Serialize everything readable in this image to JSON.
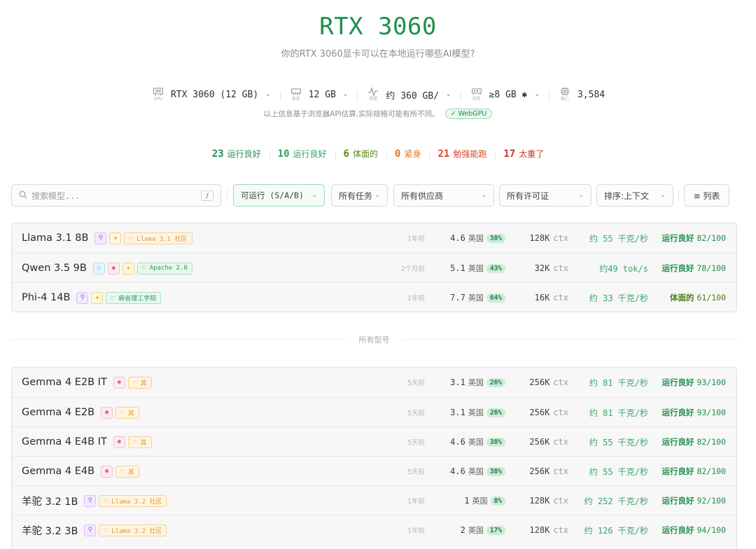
{
  "header": {
    "title": "RTX 3060",
    "subtitle": "你的RTX 3060显卡可以在本地运行哪些AI模型?"
  },
  "specs": [
    {
      "cap": "GPU",
      "value": "RTX 3060 (12 GB)",
      "caret": "⌄",
      "icon": "gpu-icon"
    },
    {
      "cap": "显存",
      "value": "12 GB",
      "caret": "⌄",
      "icon": "vram-icon"
    },
    {
      "cap": "带宽",
      "value": "约 360 GB/",
      "caret": "⌄",
      "icon": "bandwidth-icon"
    },
    {
      "cap": "内存",
      "value": "≥8 GB ✱",
      "caret": "⌄",
      "icon": "memory-icon"
    },
    {
      "cap": "核心",
      "value": "3,584",
      "caret": "",
      "icon": "cpu-icon"
    }
  ],
  "note": {
    "text": "以上信息基于浏览器API估算,实际规格可能有所不同。",
    "badge": "✓ WebGPU"
  },
  "summary": [
    {
      "count": "23",
      "label": "运行良好",
      "color": "#1f8f4e"
    },
    {
      "count": "10",
      "label": "运行良好",
      "color": "#2ea35f"
    },
    {
      "count": "6",
      "label": "体面的",
      "color": "#5c8a1c"
    },
    {
      "count": "0",
      "label": "紧身",
      "color": "#e07a1f"
    },
    {
      "count": "21",
      "label": "勉强能跑",
      "color": "#d9452b"
    },
    {
      "count": "17",
      "label": "太重了",
      "color": "#c8362a"
    }
  ],
  "filters": {
    "search_placeholder": "搜索模型...",
    "search_shortcut": "/",
    "runnable": "可运行 (S/A/B)",
    "tasks": "所有任务",
    "vendors": "所有供应商",
    "licenses": "所有许可证",
    "sort": "排序:上下文",
    "view": "≡ 列表"
  },
  "featured": [
    {
      "name": "Llama 3.1 8B",
      "tags": [
        {
          "t": "purple",
          "g": "⚲",
          "k": "tool-icon"
        },
        {
          "t": "star",
          "g": "★",
          "k": "star-icon"
        }
      ],
      "license": {
        "style": "lic-o",
        "text": "♡ Llama 3.1 社区"
      },
      "age": "1年前",
      "size": "4.6",
      "unit": "英国",
      "pct": "38%",
      "ctx": "128K",
      "ctx_unit": "ctx",
      "speed": "约 55 千克/秒",
      "grade": "运行良好",
      "score": "82/100",
      "gcolor": "#1f8f4e"
    },
    {
      "name": "Qwen 3.5 9B",
      "tags": [
        {
          "t": "blue",
          "g": "◌",
          "k": "lightbulb-icon"
        },
        {
          "t": "pink",
          "g": "◉",
          "k": "eye-icon"
        },
        {
          "t": "star",
          "g": "★",
          "k": "star-icon"
        }
      ],
      "license": {
        "style": "lic-g",
        "text": "♡ Apache 2.0"
      },
      "age": "2个月前",
      "size": "5.1",
      "unit": "英国",
      "pct": "43%",
      "ctx": "32K",
      "ctx_unit": "ctx",
      "speed": "约49 tok/s",
      "grade": "运行良好",
      "score": "78/100",
      "gcolor": "#1f8f4e"
    },
    {
      "name": "Phi-4 14B",
      "tags": [
        {
          "t": "purple",
          "g": "⚲",
          "k": "tool-icon"
        },
        {
          "t": "star",
          "g": "★",
          "k": "star-icon"
        }
      ],
      "license": {
        "style": "lic-g",
        "text": "♡ 麻省理工学院"
      },
      "age": "1年前",
      "size": "7.7",
      "unit": "英国",
      "pct": "64%",
      "ctx": "16K",
      "ctx_unit": "ctx",
      "speed": "约 33 千克/秒",
      "grade": "体面的",
      "score": "61/100",
      "gcolor": "#4f7d14"
    }
  ],
  "divider_label": "所有型号",
  "models": [
    {
      "name": "Gemma 4 E2B IT",
      "tags": [
        {
          "t": "pink",
          "g": "◉",
          "k": "eye-icon"
        }
      ],
      "license": {
        "style": "lic-o",
        "text": "♡ 其"
      },
      "age": "5天前",
      "size": "3.1",
      "unit": "英国",
      "pct": "26%",
      "ctx": "256K",
      "ctx_unit": "ctx",
      "speed": "约 81 千克/秒",
      "grade": "运行良好",
      "score": "93/100",
      "gcolor": "#1f8f4e"
    },
    {
      "name": "Gemma 4 E2B",
      "tags": [
        {
          "t": "pink",
          "g": "◉",
          "k": "eye-icon"
        }
      ],
      "license": {
        "style": "lic-o",
        "text": "♡ 其"
      },
      "age": "5天前",
      "size": "3.1",
      "unit": "英国",
      "pct": "26%",
      "ctx": "256K",
      "ctx_unit": "ctx",
      "speed": "约 81 千克/秒",
      "grade": "运行良好",
      "score": "93/100",
      "gcolor": "#1f8f4e"
    },
    {
      "name": "Gemma 4 E4B IT",
      "tags": [
        {
          "t": "pink",
          "g": "◉",
          "k": "eye-icon"
        }
      ],
      "license": {
        "style": "lic-o",
        "text": "♡ 其"
      },
      "age": "5天前",
      "size": "4.6",
      "unit": "英国",
      "pct": "38%",
      "ctx": "256K",
      "ctx_unit": "ctx",
      "speed": "约 55 千克/秒",
      "grade": "运行良好",
      "score": "82/100",
      "gcolor": "#1f8f4e"
    },
    {
      "name": "Gemma 4 E4B",
      "tags": [
        {
          "t": "pink",
          "g": "◉",
          "k": "eye-icon"
        }
      ],
      "license": {
        "style": "lic-o",
        "text": "♡ 其"
      },
      "age": "5天前",
      "size": "4.6",
      "unit": "英国",
      "pct": "38%",
      "ctx": "256K",
      "ctx_unit": "ctx",
      "speed": "约 55 千克/秒",
      "grade": "运行良好",
      "score": "82/100",
      "gcolor": "#1f8f4e"
    },
    {
      "name": "羊驼 3.2 1B",
      "tags": [
        {
          "t": "purple",
          "g": "⚲",
          "k": "tool-icon"
        }
      ],
      "license": {
        "style": "lic-o",
        "text": "♡ Llama 3.2 社区"
      },
      "age": "1年前",
      "size": "1",
      "unit": "英国",
      "pct": "8%",
      "ctx": "128K",
      "ctx_unit": "ctx",
      "speed": "约 252 千克/秒",
      "grade": "运行良好",
      "score": "92/100",
      "gcolor": "#1f8f4e"
    },
    {
      "name": "羊驼 3.2 3B",
      "tags": [
        {
          "t": "purple",
          "g": "⚲",
          "k": "tool-icon"
        }
      ],
      "license": {
        "style": "lic-o",
        "text": "♡ Llama 3.2 社区"
      },
      "age": "1年前",
      "size": "2",
      "unit": "英国",
      "pct": "17%",
      "ctx": "128K",
      "ctx_unit": "ctx",
      "speed": "约 126 千克/秒",
      "grade": "运行良好",
      "score": "94/100",
      "gcolor": "#1f8f4e"
    }
  ]
}
